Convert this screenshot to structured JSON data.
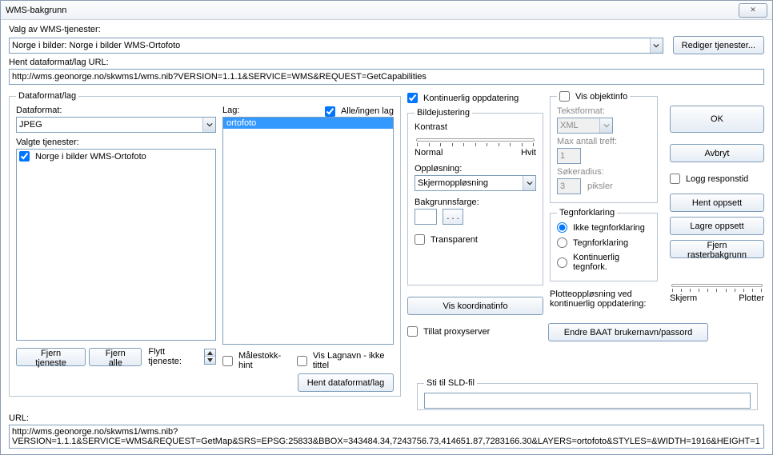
{
  "window": {
    "title": "WMS-bakgrunn",
    "close_glyph": "✕"
  },
  "top": {
    "services_label": "Valg av WMS-tjenester:",
    "service_selected": "Norge i bilder: Norge i bilder WMS-Ortofoto",
    "edit_services_btn": "Rediger tjenester...",
    "url_label": "Hent dataformat/lag URL:",
    "url_value": "http://wms.geonorge.no/skwms1/wms.nib?VERSION=1.1.1&SERVICE=WMS&REQUEST=GetCapabilities"
  },
  "dflag": {
    "legend": "Dataformat/lag",
    "format_label": "Dataformat:",
    "format_value": "JPEG",
    "layer_label": "Lag:",
    "all_none_label": "Alle/ingen lag",
    "layers": [
      "ortofoto"
    ],
    "selected_services_label": "Valgte tjenester:",
    "selected_services": [
      {
        "checked": true,
        "name": "Norge i bilder WMS-Ortofoto"
      }
    ],
    "btn_remove": "Fjern tjeneste",
    "btn_remove_all": "Fjern alle",
    "move_label": "Flytt tjeneste:",
    "chk_scale_hint": "Målestokk-hint",
    "chk_layer_name": "Vis Lagnavn - ikke tittel",
    "btn_fetch": "Hent dataformat/lag"
  },
  "mid": {
    "chk_continuous": "Kontinuerlig oppdatering",
    "bilde_legend": "Bildejustering",
    "kontrast_label": "Kontrast",
    "normal_label": "Normal",
    "hvit_label": "Hvit",
    "opplosning_label": "Oppløsning:",
    "opplosning_value": "Skjermoppløsning",
    "bgcolor_label": "Bakgrunnsfarge:",
    "bgcolor_btn": ". . .",
    "chk_transparent": "Transparent",
    "vis_koord_btn": "Vis koordinatinfo",
    "chk_proxy": "Tillat proxyserver",
    "sld_legend": "Sti til SLD-fil"
  },
  "obj": {
    "chk_vis_obj": "Vis objektinfo",
    "tekstformat_label": "Tekstformat:",
    "tekstformat_value": "XML",
    "max_label": "Max antall treff:",
    "max_value": "1",
    "radius_label": "Søkeradius:",
    "radius_value": "3",
    "radius_unit": "piksler",
    "tegn_legend": "Tegnforklaring",
    "tegn_opts": [
      "Ikke tegnforklaring",
      "Tegnforklaring",
      "Kontinuerlig tegnfork."
    ],
    "plot_label": "Plotteoppløsning ved kontinuerlig oppdatering:",
    "skjerm_label": "Skjerm",
    "plotter_label": "Plotter",
    "baat_btn": "Endre BAAT brukernavn/passord"
  },
  "right": {
    "ok": "OK",
    "avbryt": "Avbryt",
    "logg": "Logg responstid",
    "hent": "Hent oppsett",
    "lagre": "Lagre oppsett",
    "fjern_raster": "Fjern rasterbakgrunn"
  },
  "bottom": {
    "url_label": "URL:",
    "url_value": "http://wms.geonorge.no/skwms1/wms.nib?VERSION=1.1.1&SERVICE=WMS&REQUEST=GetMap&SRS=EPSG:25833&BBOX=343484.34,7243756.73,414651.87,7283166.30&LAYERS=ortofoto&STYLES=&WIDTH=1916&HEIGHT=1"
  }
}
